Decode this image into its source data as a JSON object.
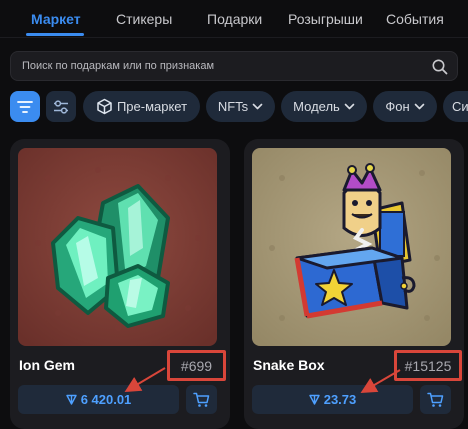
{
  "tabs": [
    {
      "label": "Маркет",
      "active": true
    },
    {
      "label": "Стикеры"
    },
    {
      "label": "Подарки"
    },
    {
      "label": "Розыгрыши"
    },
    {
      "label": "События"
    }
  ],
  "search": {
    "placeholder": "Поиск по подаркам или по признакам"
  },
  "filters": {
    "premarket": "Пре-маркет",
    "nfts": "NFTs",
    "model": "Модель",
    "background": "Фон",
    "cut_chip": "Си"
  },
  "items": [
    {
      "name": "Ion Gem",
      "number": "#699",
      "price": "6 420.01",
      "currency_icon": "ton-icon"
    },
    {
      "name": "Snake Box",
      "number": "#15125",
      "price": "23.73",
      "currency_icon": "ton-icon"
    }
  ],
  "colors": {
    "accent": "#3b8cf0",
    "price": "#4ea0ff",
    "highlight": "#d9463a",
    "card_bg": "#1c1c20",
    "gem_bg": "#7a3a32",
    "box_bg": "#a39677"
  }
}
